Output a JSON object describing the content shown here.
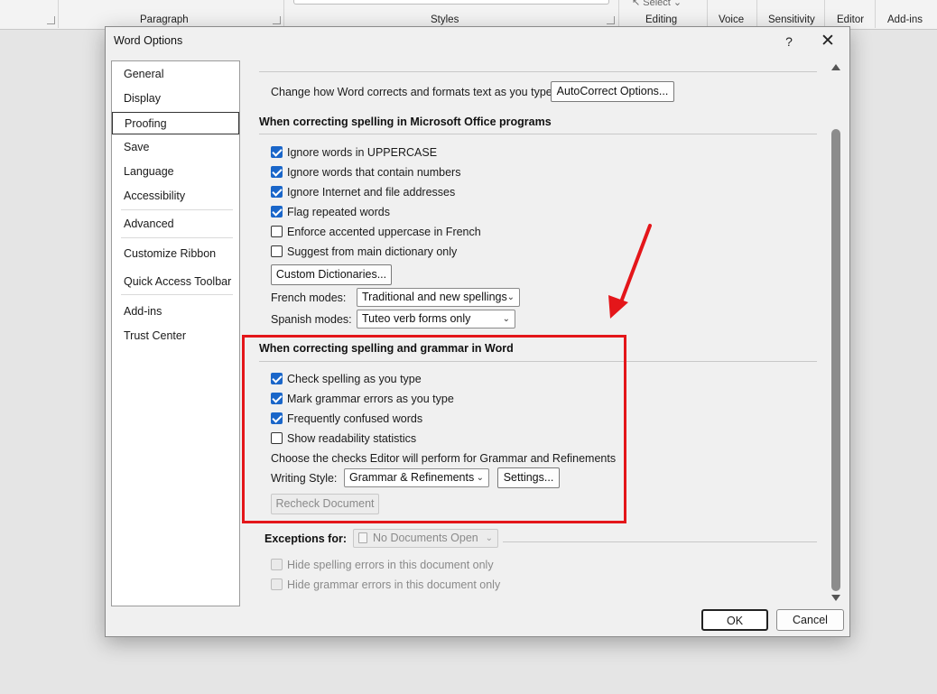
{
  "ribbon": {
    "groups": [
      "Paragraph",
      "Styles",
      "Editing",
      "Voice",
      "Sensitivity",
      "Editor",
      "Add-ins"
    ],
    "select_label": "Select"
  },
  "dialog": {
    "title": "Word Options",
    "help_label": "?",
    "close_label": "✕"
  },
  "nav": {
    "items": [
      "General",
      "Display",
      "Proofing",
      "Save",
      "Language",
      "Accessibility",
      "Advanced",
      "Customize Ribbon",
      "Quick Access Toolbar",
      "Add-ins",
      "Trust Center"
    ],
    "active": "Proofing"
  },
  "autocorrect": {
    "description": "Change how Word corrects and formats text as you type:",
    "button": "AutoCorrect Options..."
  },
  "office_spelling": {
    "heading": "When correcting spelling in Microsoft Office programs",
    "options": [
      {
        "label": "Ignore words in UPPERCASE",
        "checked": true
      },
      {
        "label": "Ignore words that contain numbers",
        "checked": true
      },
      {
        "label": "Ignore Internet and file addresses",
        "checked": true
      },
      {
        "label": "Flag repeated words",
        "checked": true
      },
      {
        "label": "Enforce accented uppercase in French",
        "checked": false
      },
      {
        "label": "Suggest from main dictionary only",
        "checked": false
      }
    ],
    "custom_dict_button": "Custom Dictionaries...",
    "french_modes_label": "French modes:",
    "french_modes_value": "Traditional and new spellings",
    "spanish_modes_label": "Spanish modes:",
    "spanish_modes_value": "Tuteo verb forms only"
  },
  "word_spelling": {
    "heading": "When correcting spelling and grammar in Word",
    "options": [
      {
        "label": "Check spelling as you type",
        "checked": true
      },
      {
        "label": "Mark grammar errors as you type",
        "checked": true
      },
      {
        "label": "Frequently confused words",
        "checked": true
      },
      {
        "label": "Show readability statistics",
        "checked": false
      }
    ],
    "checks_description": "Choose the checks Editor will perform for Grammar and Refinements",
    "writing_style_label": "Writing Style:",
    "writing_style_value": "Grammar & Refinements",
    "settings_button": "Settings...",
    "recheck_button": "Recheck Document"
  },
  "exceptions": {
    "label": "Exceptions for:",
    "value": "No Documents Open",
    "options": [
      {
        "label": "Hide spelling errors in this document only",
        "checked": false
      },
      {
        "label": "Hide grammar errors in this document only",
        "checked": false
      }
    ]
  },
  "footer": {
    "ok": "OK",
    "cancel": "Cancel"
  },
  "colors": {
    "annotation": "#e4161a",
    "checkbox_accent": "#1a66c9"
  }
}
